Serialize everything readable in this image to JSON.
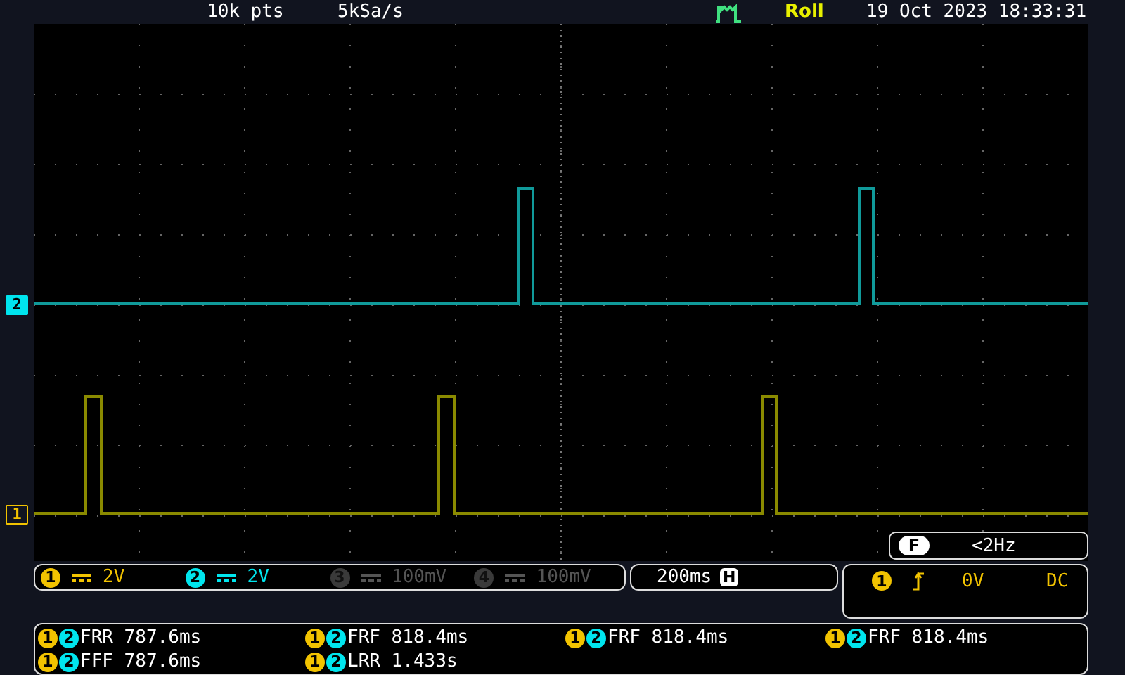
{
  "header": {
    "memory_depth": "10k pts",
    "sample_rate": "5kSa/s",
    "mode": "Roll",
    "datetime": "19 Oct 2023 18:33:31"
  },
  "markers": [
    {
      "label": "2",
      "color": "#00e5ee",
      "filled": true
    },
    {
      "label": "1",
      "color": "#f2c300",
      "filled": false
    }
  ],
  "frequency": {
    "label": "F",
    "value": "<2Hz"
  },
  "channels": [
    {
      "number": "1",
      "scale": "2V",
      "enabled": true,
      "color": "#f2c300"
    },
    {
      "number": "2",
      "scale": "2V",
      "enabled": true,
      "color": "#00e5ee"
    },
    {
      "number": "3",
      "scale": "100mV",
      "enabled": false
    },
    {
      "number": "4",
      "scale": "100mV",
      "enabled": false
    }
  ],
  "timebase": {
    "value": "200ms",
    "label": "H"
  },
  "trigger": {
    "source": "1",
    "level": "0V",
    "coupling": "DC",
    "color": "#f2c300"
  },
  "measurements": [
    {
      "sources": [
        {
          "label": "1",
          "color": "#f2c300"
        },
        {
          "label": "2",
          "color": "#00e5ee"
        }
      ],
      "name": "FRR",
      "value": "787.6ms"
    },
    {
      "sources": [
        {
          "label": "1",
          "color": "#f2c300"
        },
        {
          "label": "2",
          "color": "#00e5ee"
        }
      ],
      "name": "FRF",
      "value": "818.4ms"
    },
    {
      "sources": [
        {
          "label": "1",
          "color": "#f2c300"
        },
        {
          "label": "2",
          "color": "#00e5ee"
        }
      ],
      "name": "FRF",
      "value": "818.4ms"
    },
    {
      "sources": [
        {
          "label": "1",
          "color": "#f2c300"
        },
        {
          "label": "2",
          "color": "#00e5ee"
        }
      ],
      "name": "FRF",
      "value": "818.4ms"
    },
    {
      "sources": [
        {
          "label": "1",
          "color": "#f2c300"
        },
        {
          "label": "2",
          "color": "#00e5ee"
        }
      ],
      "name": "FFF",
      "value": "787.6ms"
    },
    {
      "sources": [
        {
          "label": "1",
          "color": "#f2c300"
        },
        {
          "label": "2",
          "color": "#00e5ee"
        }
      ],
      "name": "LRR",
      "value": "1.433s"
    }
  ]
}
